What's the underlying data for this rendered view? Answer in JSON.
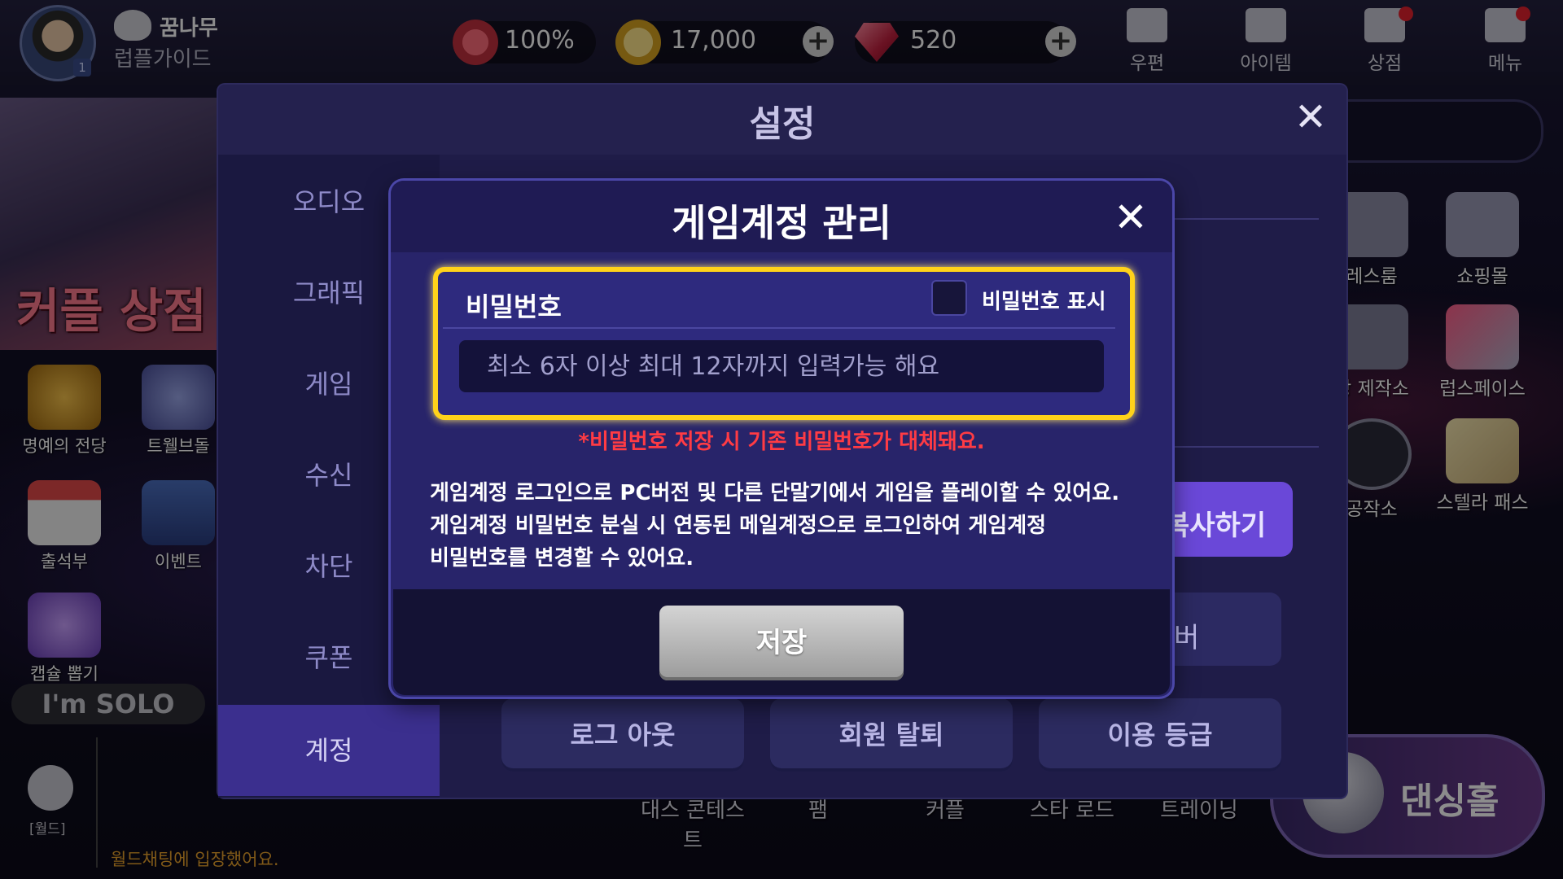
{
  "topbar": {
    "nickname": "꿈나무",
    "subtitle": "럽플가이드",
    "level": "1",
    "heart": "100%",
    "gold": "17,000",
    "gems": "520",
    "nav": [
      {
        "label": "우편",
        "icon": "mail-icon"
      },
      {
        "label": "아이템",
        "icon": "briefcase-icon"
      },
      {
        "label": "상점",
        "icon": "store-icon"
      },
      {
        "label": "메뉴",
        "icon": "grid-menu-icon"
      }
    ]
  },
  "left_sidebar": {
    "couple_shop": "커플 상점",
    "items": [
      {
        "label": "명예의 전당"
      },
      {
        "label": "트웰브돌"
      },
      {
        "label": "출석부"
      },
      {
        "label": "이벤트"
      },
      {
        "label": "캡슐 뽑기"
      }
    ],
    "solo": "I'm SOLO",
    "world_label": "[월드]",
    "world_chat": "월드채팅에 입장했어요."
  },
  "right_sidebar": {
    "items": [
      {
        "label": "레스룸"
      },
      {
        "label": "쇼핑몰"
      },
      {
        "label": "탕 제작소"
      },
      {
        "label": "럽스페이스"
      },
      {
        "label": "공작소"
      },
      {
        "label": "스텔라 패스"
      }
    ],
    "dancing_hall": "댄싱홀"
  },
  "bottom_nav": [
    {
      "label": "대스 콘테스트"
    },
    {
      "label": "팸"
    },
    {
      "label": "커플"
    },
    {
      "label": "스타 로드"
    },
    {
      "label": "트레이닝"
    }
  ],
  "settings": {
    "title": "설정",
    "tabs": [
      "오디오",
      "그래픽",
      "게임",
      "수신",
      "차단",
      "쿠폰",
      "계정"
    ],
    "active_tab": "계정",
    "copy_button_partial": "복사하기",
    "change_button_partial": "버",
    "account_buttons": [
      "로그 아웃",
      "회원 탈퇴",
      "이용 등급"
    ]
  },
  "dialog": {
    "title": "게임계정 관리",
    "password_label": "비밀번호",
    "show_password_label": "비밀번호 표시",
    "password_placeholder": "최소 6자 이상 최대 12자까지 입력가능 해요",
    "password_value": "",
    "warning": "*비밀번호 저장 시 기존 비밀번호가 대체돼요.",
    "description_lines": [
      "게임계정 로그인으로 PC버전 및 다른 단말기에서 게임을 플레이할 수 있어요.",
      "게임계정 비밀번호 분실 시 연동된 메일계정으로 로그인하여 게임계정",
      "비밀번호를 변경할 수 있어요."
    ],
    "save_label": "저장"
  },
  "colors": {
    "highlight_border": "#ffd21a",
    "warning": "#ff3b44",
    "dialog_bg": "#28246a",
    "active_tab": "#3b2f8e"
  }
}
